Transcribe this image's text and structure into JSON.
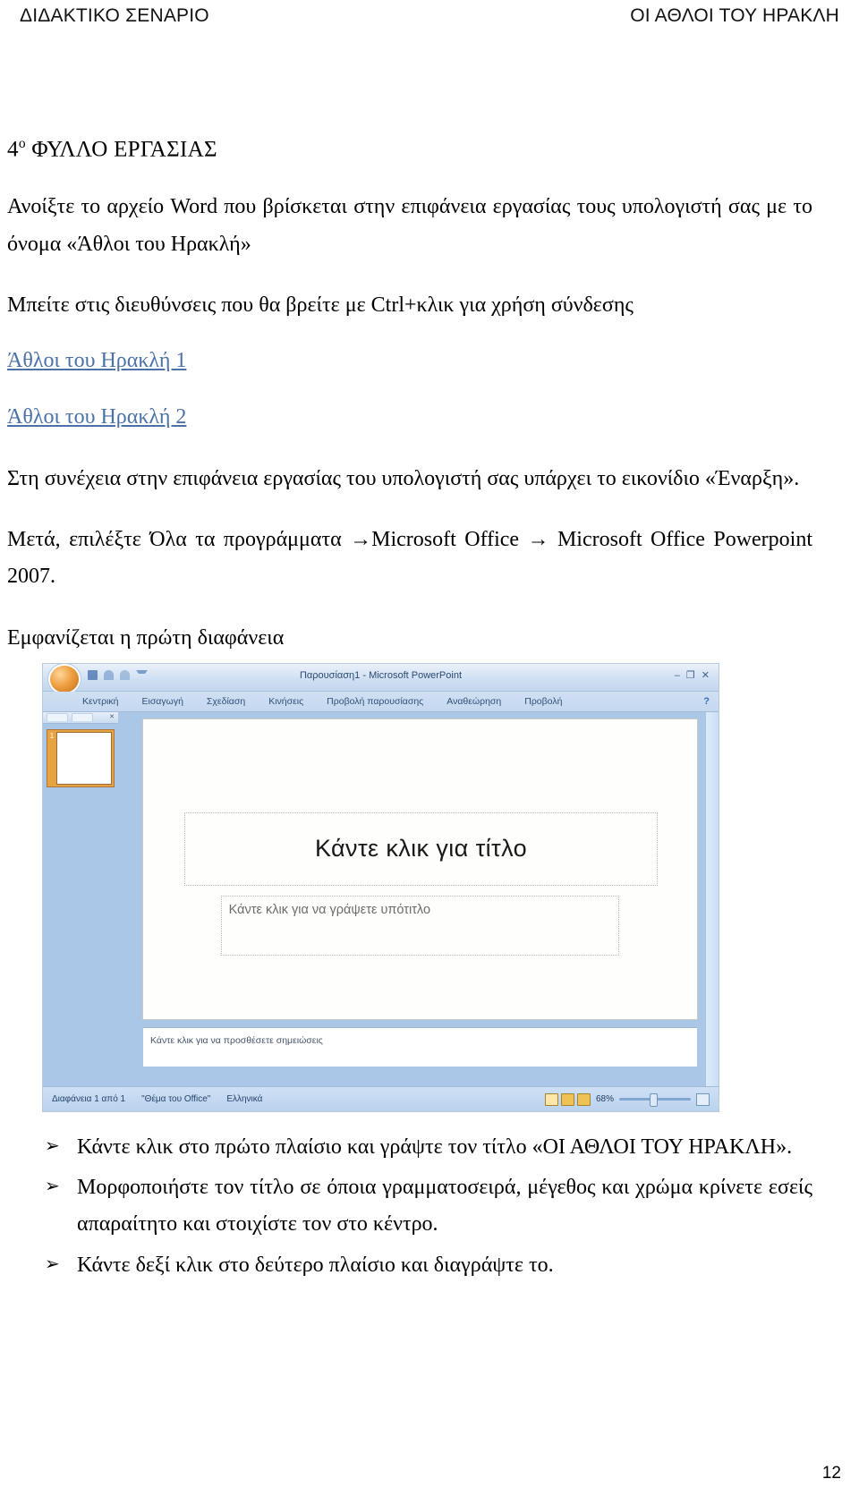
{
  "header": {
    "left": "ΔΙΔΑΚΤΙΚΟ ΣΕΝΑΡΙΟ",
    "right": "ΟΙ ΑΘΛΟΙ ΤΟΥ ΗΡΑΚΛΗ"
  },
  "worksheet": {
    "title_number": "4",
    "title_ordinal": "ο",
    "title_text": " ΦΥΛΛΟ ΕΡΓΑΣΙΑΣ"
  },
  "paragraphs": {
    "p1": "Ανοίξτε το αρχείο Word  που βρίσκεται στην επιφάνεια  εργασίας τους υπολογιστή σας με το όνομα «Άθλοι του Ηρακλή»",
    "p2": "Μπείτε στις διευθύνσεις που θα βρείτε  με Ctrl+κλικ για χρήση σύνδεσης",
    "p3": "Στη συνέχεια στην επιφάνεια εργασίας του υπολογιστή σας υπάρχει το εικονίδιο «Έναρξη».",
    "p4": "Μετά, επιλέξτε Όλα τα προγράμματα →Microsoft Office → Microsoft Office Powerpoint 2007.",
    "p5": "Εμφανίζεται η πρώτη διαφάνεια"
  },
  "links": [
    {
      "label": "Άθλοι του Ηρακλή 1"
    },
    {
      "label": "Άθλοι του Ηρακλή 2"
    }
  ],
  "powerpoint": {
    "document_title": "Παρουσίαση1 - Microsoft PowerPoint",
    "window_buttons": "–  ❐  ✕",
    "help": "?",
    "tabs": [
      "Κεντρική",
      "Εισαγωγή",
      "Σχεδίαση",
      "Κινήσεις",
      "Προβολή παρουσίασης",
      "Αναθεώρηση",
      "Προβολή"
    ],
    "slide_thumb_number": "1",
    "pane_close": "✕",
    "slide": {
      "title_placeholder": "Κάντε κλικ για τίτλο",
      "subtitle_placeholder": "Κάντε κλικ για να γράψετε υπότιτλο"
    },
    "notes_placeholder": "Κάντε κλικ για να προσθέσετε σημειώσεις",
    "status": {
      "slide_counter": "Διαφάνεια 1 από 1",
      "theme": "\"Θέμα του Office\"",
      "language": "Ελληνικά",
      "zoom_percent": "68%"
    }
  },
  "bullets": [
    {
      "marker": "➢",
      "text": "Κάντε κλικ στο πρώτο πλαίσιο και γράψτε τον τίτλο «ΟΙ ΑΘΛΟΙ ΤΟΥ ΗΡΑΚΛΗ»."
    },
    {
      "marker": "➢",
      "text": "Μορφοποιήστε τον τίτλο σε όποια γραμματοσειρά, μέγεθος και χρώμα κρίνετε εσείς απαραίτητο και στοιχίστε τον στο κέντρο."
    },
    {
      "marker": "➢",
      "text": "Κάντε δεξί κλικ στο δεύτερο πλαίσιο και διαγράψτε το."
    }
  ],
  "page_number": "12"
}
